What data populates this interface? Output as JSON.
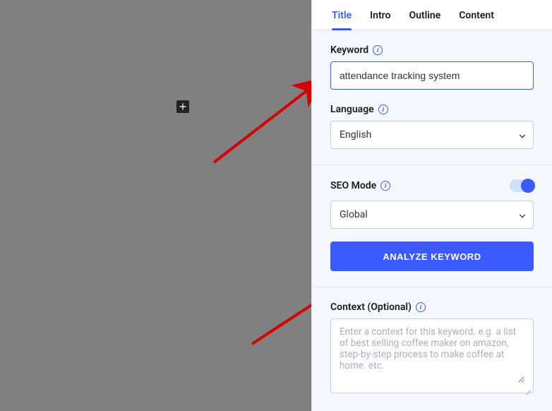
{
  "tabs": {
    "title": {
      "label": "Title",
      "active": true
    },
    "intro": {
      "label": "Intro",
      "active": false
    },
    "outline": {
      "label": "Outline",
      "active": false
    },
    "content": {
      "label": "Content",
      "active": false
    }
  },
  "keyword_section": {
    "label": "Keyword",
    "value": "attendance tracking system",
    "language_label": "Language",
    "language_value": "English"
  },
  "seo_section": {
    "label": "SEO Mode",
    "scope_value": "Global",
    "toggle_on": true,
    "analyze_button": "ANALYZE KEYWORD"
  },
  "context_section": {
    "label": "Context (Optional)",
    "placeholder": "Enter a context for this keyword. e.g. a list of best selling coffee maker on amazon, step-by-step process to make coffee at home. etc.",
    "value": ""
  },
  "canvas": {
    "add_block_tooltip": "Add block"
  },
  "colors": {
    "accent": "#3b5bff",
    "canvas_bg": "#808080",
    "arrow": "#d40000"
  }
}
